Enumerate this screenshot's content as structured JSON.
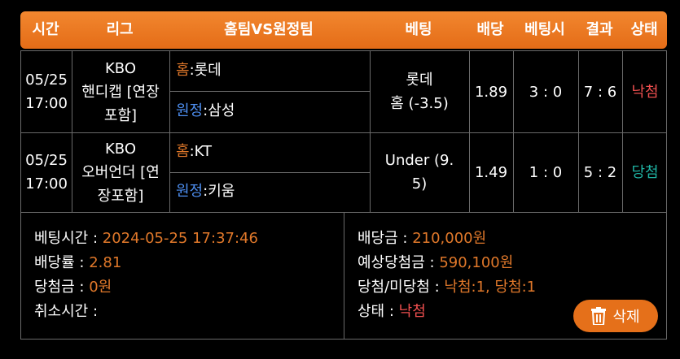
{
  "header": {
    "time": "시간",
    "league": "리그",
    "match": "홈팀VS원정팀",
    "bet": "베팅",
    "odds": "배당",
    "bet_time": "베팅시",
    "result": "결과",
    "status": "상태"
  },
  "rows": [
    {
      "date": "05/25",
      "time": "17:00",
      "league_line1": "KBO",
      "league_line2": "핸디캡 [연장",
      "league_line3": "포함]",
      "home_label": "홈",
      "home_team": ":롯데",
      "away_label": "원정",
      "away_team": ":삼성",
      "bet_line1": "롯데",
      "bet_line2": "홈 (-3.5)",
      "odds": "1.89",
      "bet_score": "3 : 0",
      "result": "7 : 6",
      "status": "낙첨"
    },
    {
      "date": "05/25",
      "time": "17:00",
      "league_line1": "KBO",
      "league_line2": "오버언더 [연",
      "league_line3": "장포함]",
      "home_label": "홈",
      "home_team": ":KT",
      "away_label": "원정",
      "away_team": ":키움",
      "bet_line1": "Under (9.",
      "bet_line2": "5)",
      "odds": "1.49",
      "bet_score": "1 : 0",
      "result": "5 : 2",
      "status": "당첨"
    }
  ],
  "summary": {
    "bet_time_label": "베팅시간 :",
    "bet_time_value": "2024-05-25 17:37:46",
    "odds_rate_label": "배당률 :",
    "odds_rate_value": "2.81",
    "win_amount_label": "당첨금 :",
    "win_amount_value": "0원",
    "cancel_time_label": "취소시간 :",
    "cancel_time_value": "",
    "bet_amount_label": "배당금 :",
    "bet_amount_value": "210,000원",
    "expected_label": "예상당첨금 :",
    "expected_value": "590,100원",
    "win_lose_label": "당첨/미당첨 :",
    "win_lose_value": "낙첨:1, 당첨:1",
    "status_label": "상태 :",
    "status_value": "낙첨"
  },
  "delete_button": {
    "label": "삭제",
    "icon": "trash-icon"
  },
  "colors": {
    "accent": "#e5701a",
    "lose": "#ef4f4f",
    "win": "#1fb3a3",
    "away": "#4d8ef0",
    "border": "#6a6a6a"
  }
}
